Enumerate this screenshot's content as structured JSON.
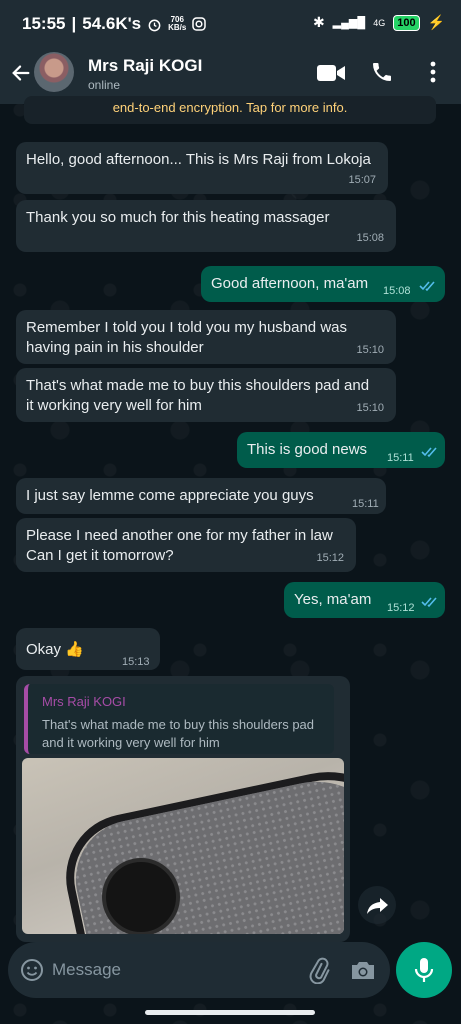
{
  "status_bar": {
    "time": "15:55",
    "speed": "54.6K's",
    "net_rate": "706",
    "net_unit": "KB/s",
    "signal": "4G",
    "battery": "100"
  },
  "header": {
    "contact_name": "Mrs Raji KOGI",
    "status": "online"
  },
  "encryption_notice": "end-to-end encryption. Tap for more info.",
  "messages": [
    {
      "direction": "in",
      "text": "Hello, good afternoon... This is Mrs Raji from Lokoja",
      "time": "15:07"
    },
    {
      "direction": "in",
      "text": "Thank you so much for this heating massager",
      "time": "15:08"
    },
    {
      "direction": "out",
      "text": "Good afternoon, ma'am",
      "time": "15:08"
    },
    {
      "direction": "in",
      "text_lines": [
        "Remember I told you I told you my husband was",
        "having pain in his  shoulder"
      ],
      "time": "15:10"
    },
    {
      "direction": "in",
      "text_lines": [
        "That's what made me to buy this shoulders pad and",
        "it working very well for him"
      ],
      "time": "15:10"
    },
    {
      "direction": "out",
      "text": "This is good news",
      "time": "15:11"
    },
    {
      "direction": "in",
      "text": "I just say lemme come appreciate you guys",
      "time": "15:11"
    },
    {
      "direction": "in",
      "text_lines": [
        "Please I need another one for my father in law",
        "Can I get it tomorrow?"
      ],
      "time": "15:12"
    },
    {
      "direction": "out",
      "text": "Yes, ma'am",
      "time": "15:12"
    },
    {
      "direction": "in",
      "text": "Okay 👍",
      "time": "15:13"
    }
  ],
  "reply_quote": {
    "name": "Mrs Raji KOGI",
    "text_lines": [
      "That's what made me to buy this shoulders pad",
      "and it working very well for him"
    ]
  },
  "input": {
    "placeholder": "Message"
  },
  "colors": {
    "accent": "#00a884",
    "outgoing": "#005c4b",
    "incoming": "#202c33",
    "quote_name": "#a64ca6",
    "read_ticks": "#53bdeb"
  }
}
